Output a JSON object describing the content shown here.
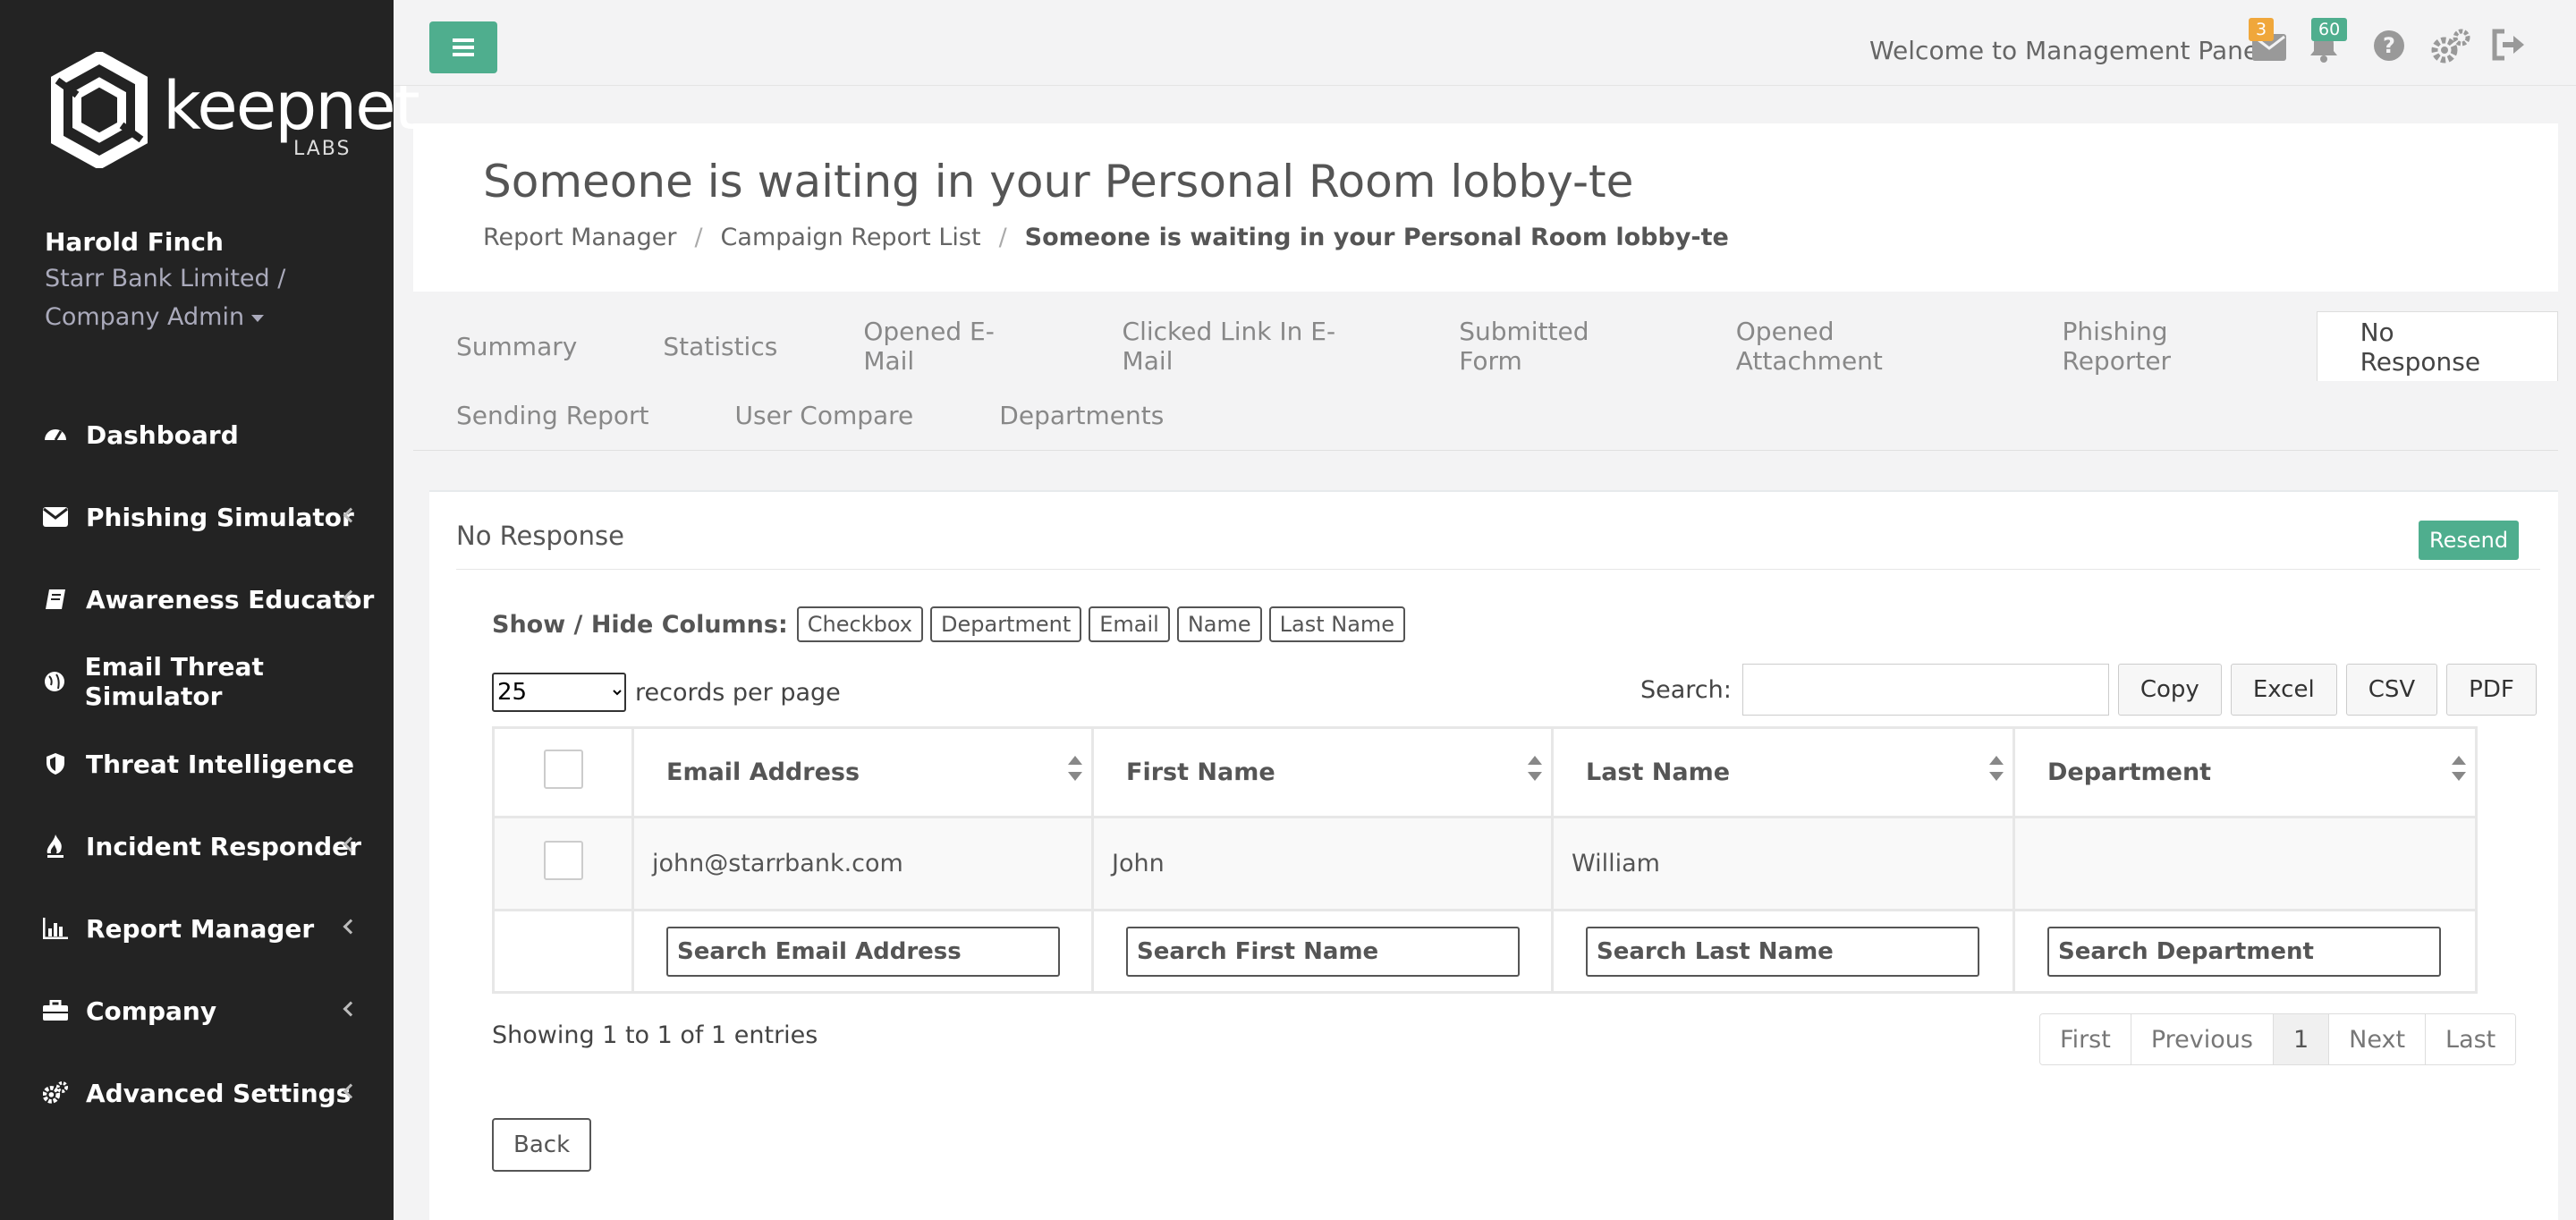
{
  "brand": {
    "logo_text": "keepnet",
    "logo_sub": "LABS"
  },
  "profile": {
    "name": "Harold Finch",
    "company": "Starr Bank Limited /",
    "role": "Company Admin"
  },
  "sidebar": {
    "items": [
      {
        "label": "Dashboard",
        "icon": "dashboard-icon",
        "has_sub": false
      },
      {
        "label": "Phishing Simulator",
        "icon": "envelope-icon",
        "has_sub": true
      },
      {
        "label": "Awareness Educator",
        "icon": "book-icon",
        "has_sub": true
      },
      {
        "label": "Email Threat Simulator",
        "icon": "globe-icon",
        "has_sub": false
      },
      {
        "label": "Threat Intelligence",
        "icon": "shield-icon",
        "has_sub": false
      },
      {
        "label": "Incident Responder",
        "icon": "fire-icon",
        "has_sub": true
      },
      {
        "label": "Report Manager",
        "icon": "bar-chart-icon",
        "has_sub": true
      },
      {
        "label": "Company",
        "icon": "briefcase-icon",
        "has_sub": true
      },
      {
        "label": "Advanced Settings",
        "icon": "gears-icon",
        "has_sub": true
      }
    ]
  },
  "topbar": {
    "welcome": "Welcome to Management Panel",
    "mail_count": "3",
    "notif_count": "60",
    "colors": {
      "mail_badge": "#f0a73b",
      "notif_badge": "#4fae8e"
    }
  },
  "header": {
    "title": "Someone is waiting in your Personal Room lobby-te",
    "breadcrumb": [
      "Report Manager",
      "Campaign Report List",
      "Someone is waiting in your Personal Room lobby-te"
    ],
    "separator": "/"
  },
  "tabs": {
    "row1": [
      "Summary",
      "Statistics",
      "Opened E-Mail",
      "Clicked Link In E-Mail",
      "Submitted Form",
      "Opened Attachment",
      "Phishing Reporter",
      "No Response"
    ],
    "row2": [
      "Sending Report",
      "User Compare",
      "Departments"
    ],
    "active": "No Response"
  },
  "panel": {
    "title": "No Response",
    "resend_label": "Resend",
    "columns_label": "Show / Hide Columns:",
    "column_toggles": [
      "Checkbox",
      "Department",
      "Email",
      "Name",
      "Last Name"
    ],
    "per_page_value": "25",
    "per_page_label": "records per page",
    "search_label": "Search:",
    "export_buttons": [
      "Copy",
      "Excel",
      "CSV",
      "PDF"
    ],
    "table": {
      "headers": [
        "Email Address",
        "First Name",
        "Last Name",
        "Department"
      ],
      "rows": [
        {
          "email": "john@starrbank.com",
          "first": "John",
          "last": "William",
          "department": ""
        }
      ],
      "filters": [
        "Search Email Address",
        "Search First Name",
        "Search Last Name",
        "Search Department"
      ]
    },
    "showing": "Showing 1 to 1 of 1 entries",
    "pager": [
      "First",
      "Previous",
      "1",
      "Next",
      "Last"
    ],
    "back_label": "Back"
  }
}
